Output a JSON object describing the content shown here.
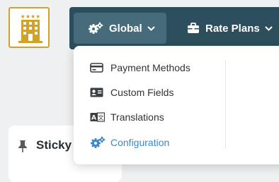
{
  "logo": {
    "icon": "hotel-icon",
    "stars": "★★★★"
  },
  "nav": {
    "global": {
      "label": "Global",
      "icon": "gears-icon"
    },
    "rate_plans": {
      "label": "Rate Plans",
      "icon": "briefcase-icon"
    }
  },
  "menu": {
    "items": [
      {
        "label": "Payment Methods",
        "icon": "credit-card-icon"
      },
      {
        "label": "Custom Fields",
        "icon": "id-card-icon"
      },
      {
        "label": "Translations",
        "icon": "language-icon"
      },
      {
        "label": "Configuration",
        "icon": "gears-icon",
        "active": true
      }
    ]
  },
  "sticky": {
    "title": "Sticky"
  },
  "colors": {
    "navbar": "#2d4e5c",
    "nav_active": "#466c7c",
    "accent": "#3f88c5",
    "logo_gold": "#d1a22a"
  }
}
